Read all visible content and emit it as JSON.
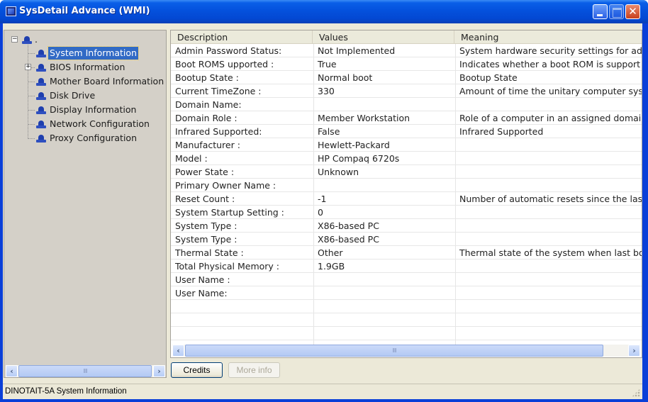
{
  "window": {
    "title": "SysDetail Advance (WMI)",
    "controls": {
      "minimize": "minimize",
      "maximize": "maximize",
      "close": "✕"
    }
  },
  "tree": {
    "root": {
      "label": ".",
      "expanded": true
    },
    "items": [
      {
        "label": "System Information",
        "selected": true,
        "expandable": false
      },
      {
        "label": "BIOS Information",
        "selected": false,
        "expandable": true
      },
      {
        "label": "Mother Board Information",
        "selected": false,
        "expandable": false
      },
      {
        "label": "Disk Drive",
        "selected": false,
        "expandable": false
      },
      {
        "label": "Display Information",
        "selected": false,
        "expandable": false
      },
      {
        "label": "Network Configuration",
        "selected": false,
        "expandable": false
      },
      {
        "label": "Proxy Configuration",
        "selected": false,
        "expandable": false
      }
    ],
    "expander_expanded": "−",
    "expander_collapsed": "+"
  },
  "list": {
    "columns": [
      "Description",
      "Values",
      "Meaning"
    ],
    "rows": [
      [
        "Admin Password Status:",
        "Not Implemented",
        "System hardware security settings for adr"
      ],
      [
        "Boot ROMS upported :",
        "True",
        " Indicates whether a boot ROM is support"
      ],
      [
        "Bootup State :",
        "Normal boot",
        "Bootup State"
      ],
      [
        "Current TimeZone :",
        "330",
        "Amount of time the unitary computer sys"
      ],
      [
        "Domain Name:",
        "",
        ""
      ],
      [
        "Domain Role :",
        "Member Workstation",
        "Role of a computer in an assigned domair"
      ],
      [
        "Infrared Supported:",
        "False",
        "Infrared Supported"
      ],
      [
        "Manufacturer :",
        "Hewlett-Packard",
        ""
      ],
      [
        "Model :",
        "HP Compaq 6720s",
        ""
      ],
      [
        "Power State :",
        "Unknown",
        ""
      ],
      [
        "Primary Owner Name :",
        "",
        ""
      ],
      [
        "Reset Count :",
        "-1",
        "Number of automatic resets since the last"
      ],
      [
        "System Startup Setting :",
        "0",
        ""
      ],
      [
        "System Type :",
        "X86-based PC",
        ""
      ],
      [
        "System Type :",
        "X86-based PC",
        ""
      ],
      [
        "Thermal State :",
        "Other",
        "Thermal state of the system when last bo"
      ],
      [
        "Total Physical Memory :",
        "1.9GB",
        ""
      ],
      [
        "User Name :",
        "",
        ""
      ],
      [
        "User Name:",
        "",
        ""
      ],
      [
        "",
        "",
        ""
      ],
      [
        "",
        "",
        ""
      ],
      [
        "",
        "",
        ""
      ]
    ]
  },
  "scrollbars": {
    "left_arrow": "‹",
    "right_arrow": "›",
    "grip": "IIII"
  },
  "buttons": {
    "credits": "Credits",
    "more_info": "More info"
  },
  "statusbar": {
    "text": "DINOTAIT-5A  System Information"
  }
}
